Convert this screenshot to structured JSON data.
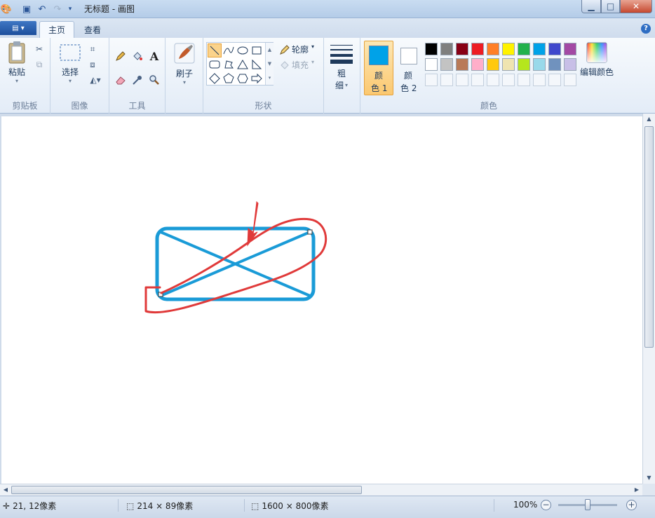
{
  "window": {
    "title": "无标题 - 画图"
  },
  "tabs": {
    "app_menu_icon": "menu-icon",
    "home": "主页",
    "view": "查看"
  },
  "ribbon": {
    "clipboard": {
      "group": "剪贴板",
      "paste": "粘贴"
    },
    "image": {
      "group": "图像",
      "select": "选择"
    },
    "tools": {
      "group": "工具"
    },
    "brushes": {
      "label": "刷子"
    },
    "shapes": {
      "group": "形状",
      "outline": "轮廓",
      "fill": "填充"
    },
    "size": {
      "label_top": "粗",
      "label_bottom": "细"
    },
    "colors": {
      "group": "颜色",
      "color1_top": "颜",
      "color1_bottom": "色 1",
      "color2_top": "颜",
      "color2_bottom": "色 2",
      "edit": "编辑颜色",
      "color1_value": "#00a2e8",
      "color2_value": "#ffffff",
      "palette_row1": [
        "#000000",
        "#7f7f7f",
        "#880015",
        "#ed1c24",
        "#ff7f27",
        "#fff200",
        "#22b14c",
        "#00a2e8",
        "#3f48cc",
        "#a349a4"
      ],
      "palette_row2": [
        "#ffffff",
        "#c3c3c3",
        "#b97a57",
        "#ffaec9",
        "#ffc90e",
        "#efe4b0",
        "#b5e61d",
        "#99d9ea",
        "#7092be",
        "#c8bfe7"
      ]
    }
  },
  "canvas": {
    "stroke_color": "#1a9bd7",
    "annotation_color": "#e03a3a"
  },
  "status": {
    "cursor_pos": "21, 12像素",
    "selection_size": "214 × 89像素",
    "image_size": "1600 × 800像素",
    "zoom": "100%"
  }
}
